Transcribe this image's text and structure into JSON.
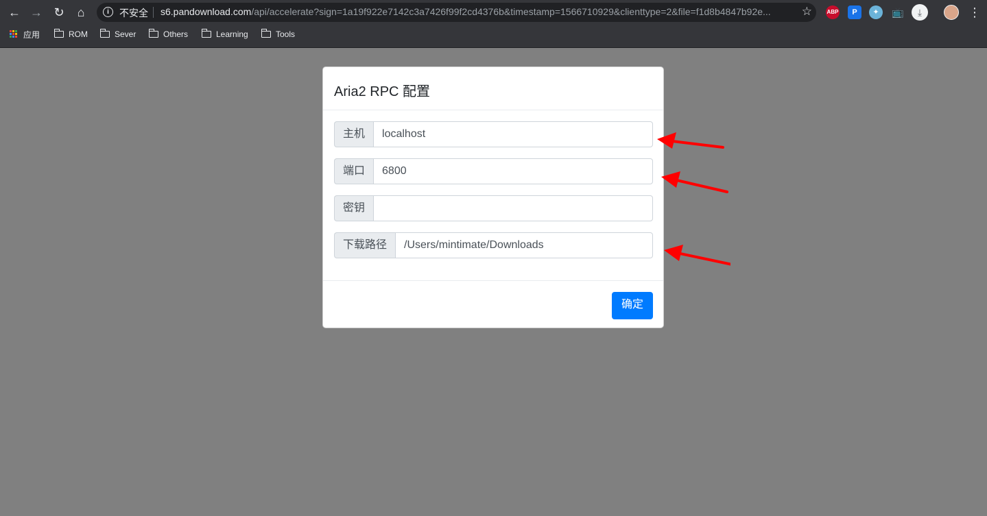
{
  "browser": {
    "security_label": "不安全",
    "url_host": "s6.pandownload.com",
    "url_path": "/api/accelerate?sign=1a19f922e7142c3a7426f99f2cd4376b&timestamp=1566710929&clienttype=2&file=f1d8b4847b92e...",
    "extensions": {
      "abp": "ABP"
    }
  },
  "bookmarks": [
    {
      "label": "应用",
      "icon": "apps-icon"
    },
    {
      "label": "ROM",
      "icon": "folder-icon"
    },
    {
      "label": "Sever",
      "icon": "folder-icon"
    },
    {
      "label": "Others",
      "icon": "folder-icon"
    },
    {
      "label": "Learning",
      "icon": "folder-icon"
    },
    {
      "label": "Tools",
      "icon": "folder-icon"
    }
  ],
  "modal": {
    "title": "Aria2 RPC 配置",
    "fields": [
      {
        "label": "主机",
        "value": "localhost"
      },
      {
        "label": "端口",
        "value": "6800"
      },
      {
        "label": "密钥",
        "value": ""
      },
      {
        "label": "下载路径",
        "value": "/Users/mintimate/Downloads"
      }
    ],
    "confirm_label": "确定"
  },
  "colors": {
    "overlay": "#808080",
    "primary": "#007bff",
    "annotation_arrow": "#ff0000"
  }
}
